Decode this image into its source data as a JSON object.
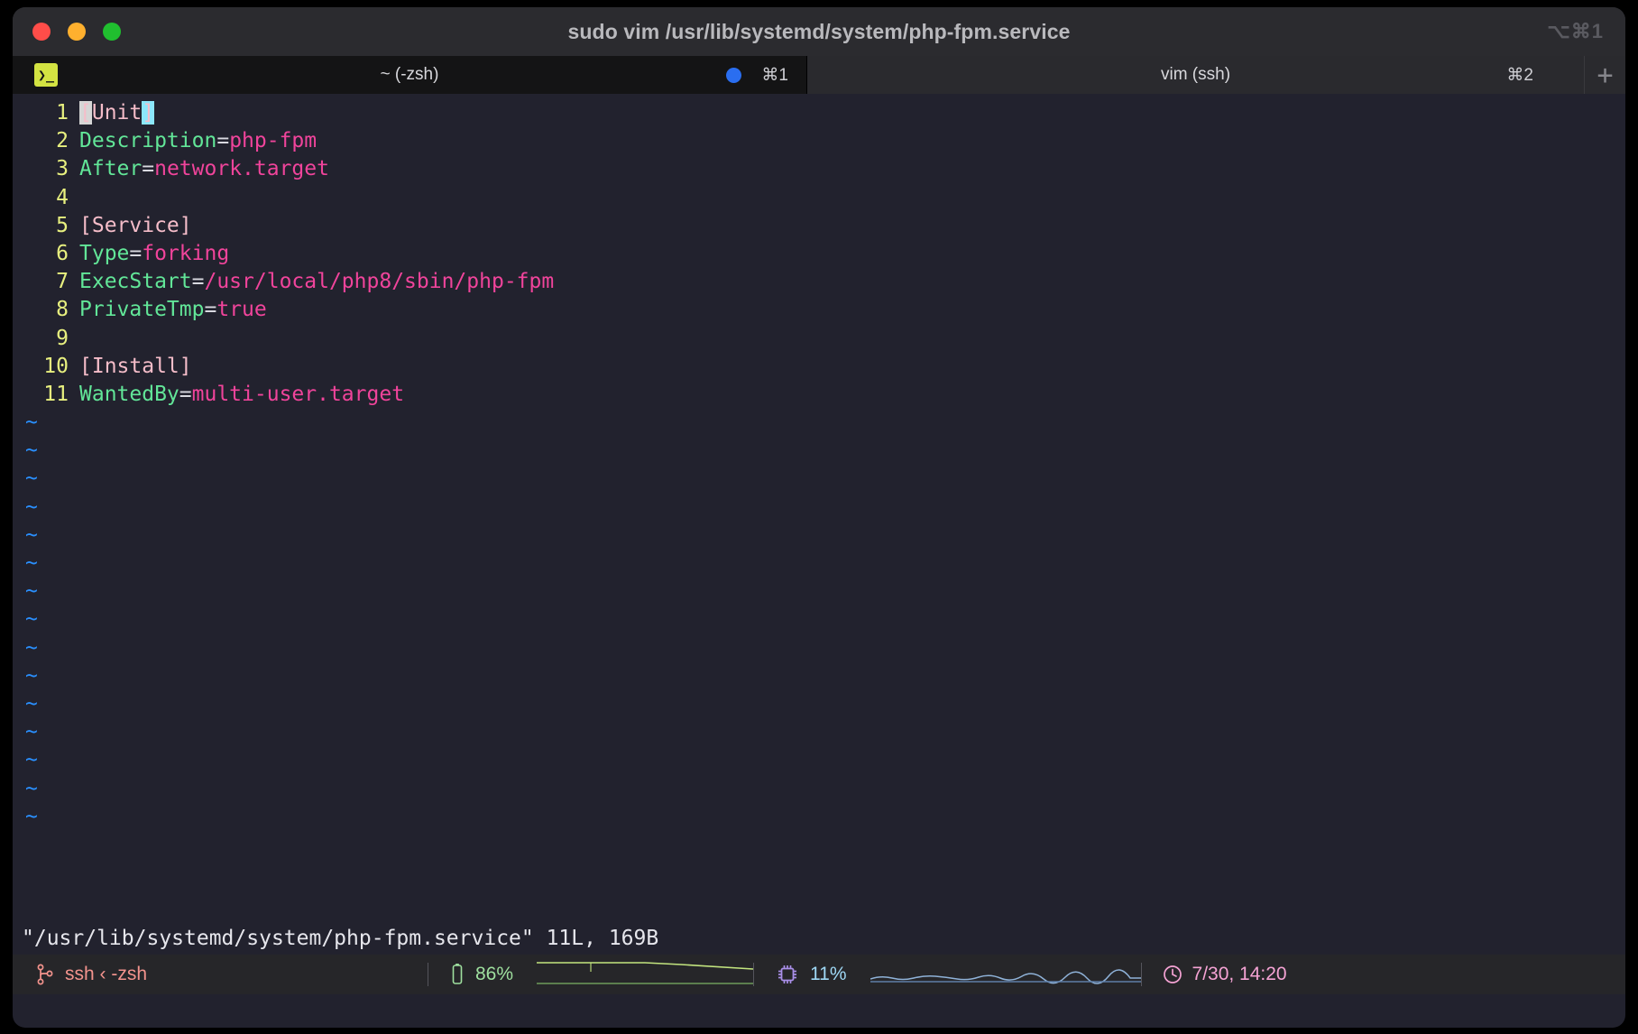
{
  "window": {
    "title": "sudo vim /usr/lib/systemd/system/php-fpm.service",
    "title_shortcut": "⌥⌘1",
    "traffic_lights": [
      "close-button",
      "minimize-button",
      "zoom-button"
    ],
    "colors": {
      "titlebar_bg": "#2b2b2f",
      "editor_bg": "#22222e",
      "tab_active_bg": "#141415",
      "tab_inactive_bg": "#2a2a2e",
      "statusbar_bg": "#262629"
    }
  },
  "tabs": [
    {
      "id": "tab-zsh",
      "label": "~ (-zsh)",
      "shortcut": "⌘1",
      "active": true,
      "icon": "terminal-prompt-icon",
      "icon_text": "❯_",
      "has_activity_dot": true,
      "dot_color": "#2a6ef0"
    },
    {
      "id": "tab-vim-ssh",
      "label": "vim (ssh)",
      "shortcut": "⌘2",
      "active": false,
      "has_activity_dot": false
    }
  ],
  "new_tab_button": "+",
  "editor": {
    "lines": [
      {
        "num": "1",
        "segments": [
          {
            "text": "[",
            "cls": "hl-paren"
          },
          {
            "text": "Unit",
            "cls": "tok-section"
          },
          {
            "text": "]",
            "cls": "hl-cursor"
          }
        ]
      },
      {
        "num": "2",
        "segments": [
          {
            "text": "Description",
            "cls": "tok-key"
          },
          {
            "text": "=",
            "cls": "tok-eq"
          },
          {
            "text": "php-fpm",
            "cls": "tok-val"
          }
        ]
      },
      {
        "num": "3",
        "segments": [
          {
            "text": "After",
            "cls": "tok-key"
          },
          {
            "text": "=",
            "cls": "tok-eq"
          },
          {
            "text": "network.target",
            "cls": "tok-val"
          }
        ]
      },
      {
        "num": "4",
        "segments": []
      },
      {
        "num": "5",
        "segments": [
          {
            "text": "[Service]",
            "cls": "tok-section"
          }
        ]
      },
      {
        "num": "6",
        "segments": [
          {
            "text": "Type",
            "cls": "tok-key"
          },
          {
            "text": "=",
            "cls": "tok-eq"
          },
          {
            "text": "forking",
            "cls": "tok-val"
          }
        ]
      },
      {
        "num": "7",
        "segments": [
          {
            "text": "ExecStart",
            "cls": "tok-key"
          },
          {
            "text": "=",
            "cls": "tok-eq"
          },
          {
            "text": "/usr/local/php8/sbin/php-fpm",
            "cls": "tok-val"
          }
        ]
      },
      {
        "num": "8",
        "segments": [
          {
            "text": "PrivateTmp",
            "cls": "tok-key"
          },
          {
            "text": "=",
            "cls": "tok-eq"
          },
          {
            "text": "true",
            "cls": "tok-val"
          }
        ]
      },
      {
        "num": "9",
        "segments": []
      },
      {
        "num": "10",
        "segments": [
          {
            "text": "[Install]",
            "cls": "tok-section"
          }
        ]
      },
      {
        "num": "11",
        "segments": [
          {
            "text": "WantedBy",
            "cls": "tok-key"
          },
          {
            "text": "=",
            "cls": "tok-eq"
          },
          {
            "text": "multi-user.target",
            "cls": "tok-val"
          }
        ]
      }
    ],
    "filler_char": "~",
    "filler_count": 15,
    "status_message": "\"/usr/lib/systemd/system/php-fpm.service\" 11L, 169B",
    "cursor": {
      "line": 1,
      "column": 6,
      "char": "]"
    }
  },
  "statusbar": {
    "ssh": {
      "icon": "git-branch-icon",
      "label": "ssh ‹ -zsh",
      "color": "#f3938d"
    },
    "battery": {
      "icon": "battery-icon",
      "value": "86%",
      "color": "#9fe09f"
    },
    "cpu": {
      "icon": "cpu-chip-icon",
      "value": "11%",
      "color": "#9fd8f5"
    },
    "time": {
      "icon": "clock-icon",
      "value": "7/30, 14:20",
      "color": "#f5a3d4"
    }
  }
}
